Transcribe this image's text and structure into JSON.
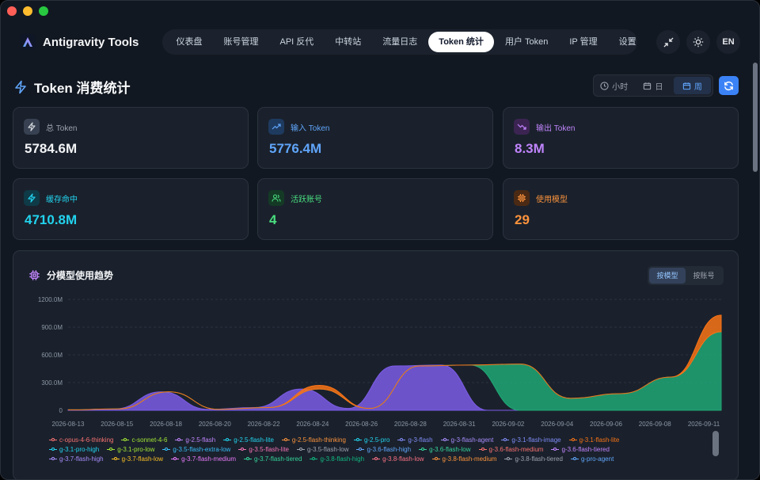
{
  "app": {
    "name": "Antigravity Tools"
  },
  "nav": {
    "items": [
      {
        "label": "仪表盘"
      },
      {
        "label": "账号管理"
      },
      {
        "label": "API 反代"
      },
      {
        "label": "中转站"
      },
      {
        "label": "流量日志"
      },
      {
        "label": "Token 统计",
        "active": true
      },
      {
        "label": "用户 Token"
      },
      {
        "label": "IP 管理"
      },
      {
        "label": "设置"
      }
    ],
    "lang": "EN",
    "icons": {
      "collapse": "minimize-icon",
      "theme": "sun-icon"
    }
  },
  "page": {
    "title": "Token 消费统计"
  },
  "range": {
    "hour": "小时",
    "day": "日",
    "week": "周",
    "active": "week"
  },
  "cards": [
    {
      "label": "总 Token",
      "value": "5784.6M",
      "icon": "bolt-icon",
      "color": "#f3f4f6",
      "label_color": "#9ca3af",
      "icon_bg": "#374151",
      "icon_color": "#d1d5db"
    },
    {
      "label": "输入 Token",
      "value": "5776.4M",
      "icon": "trending-up-icon",
      "color": "#60a5fa",
      "label_color": "#60a5fa",
      "icon_bg": "#1e3a5f",
      "icon_color": "#60a5fa"
    },
    {
      "label": "输出 Token",
      "value": "8.3M",
      "icon": "trending-down-icon",
      "color": "#c084fc",
      "label_color": "#c084fc",
      "icon_bg": "#3b2452",
      "icon_color": "#c084fc"
    },
    {
      "label": "缓存命中",
      "value": "4710.8M",
      "icon": "bolt-icon",
      "color": "#22d3ee",
      "label_color": "#22d3ee",
      "icon_bg": "#0f3a47",
      "icon_color": "#22d3ee"
    },
    {
      "label": "活跃账号",
      "value": "4",
      "icon": "users-icon",
      "color": "#4ade80",
      "label_color": "#4ade80",
      "icon_bg": "#143a25",
      "icon_color": "#4ade80"
    },
    {
      "label": "使用模型",
      "value": "29",
      "icon": "chip-icon",
      "color": "#fb923c",
      "label_color": "#fb923c",
      "icon_bg": "#4a2a14",
      "icon_color": "#fb923c"
    }
  ],
  "chart_panel": {
    "title": "分模型使用趋势",
    "toggle": {
      "by_model": "按模型",
      "by_account": "按账号",
      "active": "by_model"
    }
  },
  "chart_data": {
    "type": "area",
    "stacked": true,
    "y_ticks": [
      "0",
      "300.0M",
      "600.0M",
      "900.0M",
      "1200.0M"
    ],
    "ylim": [
      0,
      1200
    ],
    "x_ticks": [
      "2026-08-13",
      "2026-08-15",
      "2026-08-18",
      "2026-08-20",
      "2026-08-22",
      "2026-08-24",
      "2026-08-26",
      "2026-08-28",
      "2026-08-31",
      "2026-09-02",
      "2026-09-04",
      "2026-09-06",
      "2026-09-08",
      "2026-09-11"
    ],
    "grid": "horizontal-dashed",
    "legend_position": "bottom",
    "series": [
      {
        "name": "g-3-flash-agent",
        "color": "#7c5ce6",
        "values": [
          5,
          15,
          200,
          10,
          30,
          230,
          20,
          480,
          490,
          0,
          0,
          0,
          0,
          0,
          0
        ]
      },
      {
        "name": "g-3.6-flash-low",
        "color": "#20a775",
        "values": [
          0,
          0,
          0,
          0,
          0,
          0,
          0,
          0,
          0,
          500,
          130,
          180,
          360,
          850
        ]
      },
      {
        "name": "g-3.8-flash-medium",
        "color": "#f97316",
        "values": [
          0,
          0,
          0,
          0,
          0,
          40,
          0,
          0,
          0,
          0,
          0,
          0,
          0,
          180
        ]
      }
    ],
    "legend": [
      {
        "name": "c-opus-4-6-thinking",
        "color": "#f87171"
      },
      {
        "name": "c-sonnet-4-6",
        "color": "#a3e635"
      },
      {
        "name": "g-2.5-flash",
        "color": "#c084fc"
      },
      {
        "name": "g-2.5-flash-lite",
        "color": "#22d3ee"
      },
      {
        "name": "g-2.5-flash-thinking",
        "color": "#fb923c"
      },
      {
        "name": "g-2.5-pro",
        "color": "#22d3ee"
      },
      {
        "name": "g-3-flash",
        "color": "#818cf8"
      },
      {
        "name": "g-3-flash-agent",
        "color": "#a78bfa"
      },
      {
        "name": "g-3.1-flash-image",
        "color": "#818cf8"
      },
      {
        "name": "g-3.1-flash-lite",
        "color": "#f97316"
      },
      {
        "name": "g-3.1-pro-high",
        "color": "#22d3ee"
      },
      {
        "name": "g-3.1-pro-low",
        "color": "#a3e635"
      },
      {
        "name": "g-3.5-flash-extra-low",
        "color": "#38bdf8"
      },
      {
        "name": "g-3.5-flash-lite",
        "color": "#f472b6"
      },
      {
        "name": "g-3.5-flash-low",
        "color": "#9ca3af"
      },
      {
        "name": "g-3.6-flash-high",
        "color": "#60a5fa"
      },
      {
        "name": "g-3.6-flash-low",
        "color": "#34d399"
      },
      {
        "name": "g-3.6-flash-medium",
        "color": "#f87171"
      },
      {
        "name": "g-3.6-flash-tiered",
        "color": "#c084fc"
      },
      {
        "name": "g-3.7-flash-high",
        "color": "#a78bfa"
      },
      {
        "name": "g-3.7-flash-low",
        "color": "#fbbf24"
      },
      {
        "name": "g-3.7-flash-medium",
        "color": "#e879f9"
      },
      {
        "name": "g-3.7-flash-tiered",
        "color": "#34d399"
      },
      {
        "name": "g-3.8-flash-high",
        "color": "#10b981"
      },
      {
        "name": "g-3.8-flash-low",
        "color": "#fb7185"
      },
      {
        "name": "g-3.8-flash-medium",
        "color": "#fb923c"
      },
      {
        "name": "g-3.8-flash-tiered",
        "color": "#9ca3af"
      },
      {
        "name": "g-pro-agent",
        "color": "#60a5fa"
      }
    ]
  }
}
